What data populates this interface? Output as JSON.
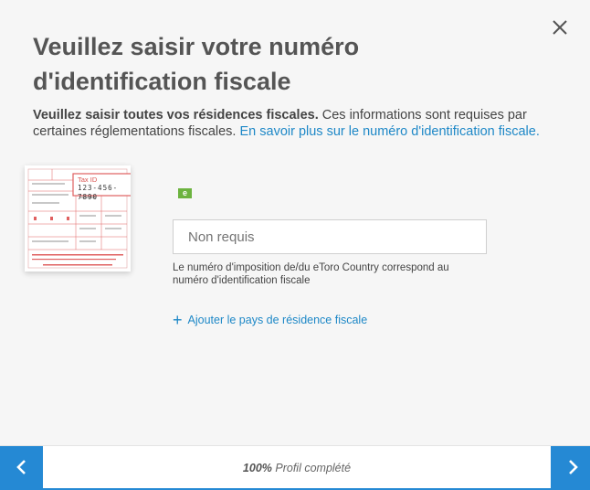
{
  "dialog": {
    "title": "Veuillez saisir votre numéro d'identification fiscale",
    "intro_bold": "Veuillez saisir toutes vos résidences fiscales.",
    "intro_text": " Ces informations sont requises par certaines réglementations fiscales. ",
    "intro_link": "En savoir plus sur le numéro d'identification fiscale.",
    "close_icon": "close-icon"
  },
  "illustration": {
    "tax_id_label": "Tax ID",
    "tax_id_value": "123-456-7890"
  },
  "form": {
    "flag_label": "e",
    "tin_placeholder": "Non requis",
    "tin_value": "",
    "help_text": "Le numéro d'imposition de/du eToro Country correspond au numéro d'identification fiscale",
    "add_country_label": "Ajouter le pays de résidence fiscale",
    "add_icon": "plus-icon"
  },
  "footer": {
    "progress_percent": "100%",
    "progress_label": " Profil complété",
    "progress_fraction": 1.0,
    "prev_icon": "chevron-left-icon",
    "next_icon": "chevron-right-icon",
    "accent_color": "#2589d4"
  }
}
